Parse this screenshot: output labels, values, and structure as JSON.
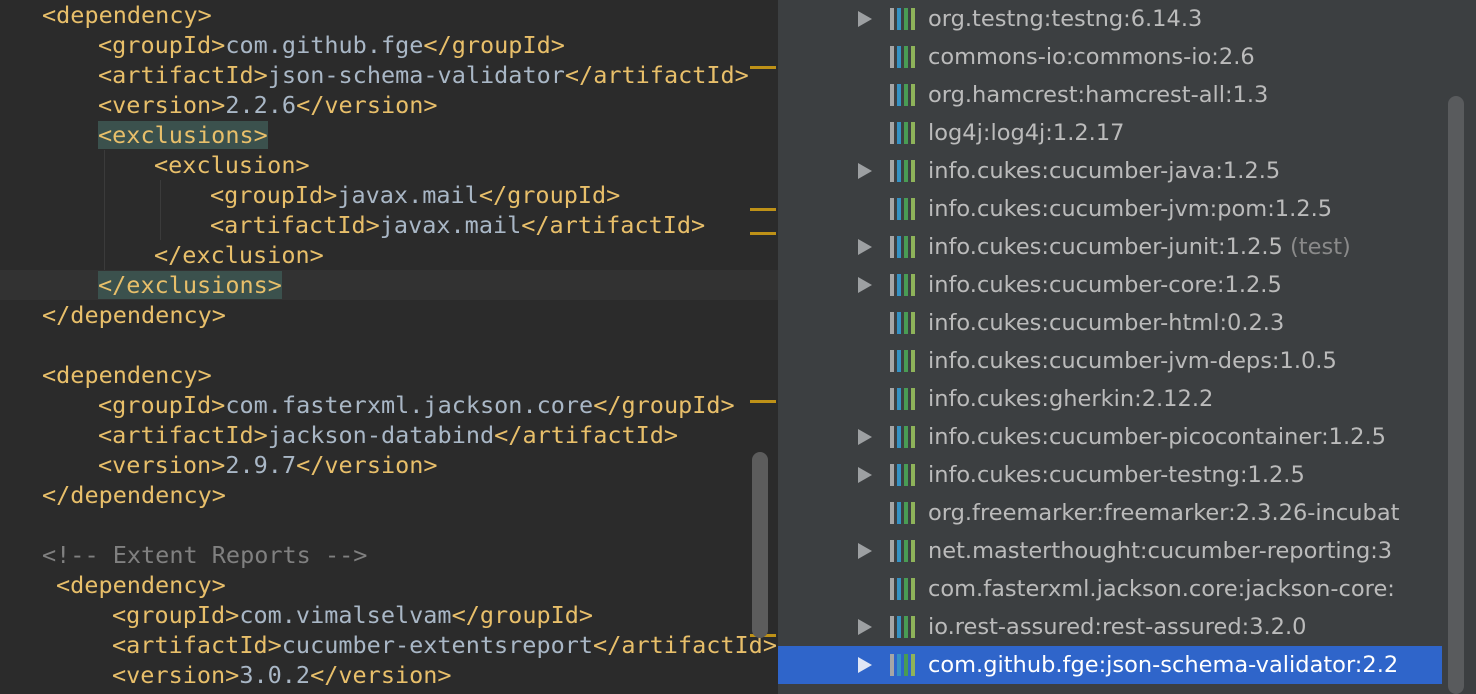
{
  "editor": {
    "lines": [
      [
        "<dependency>"
      ],
      [
        "<groupId>",
        "com.github.fge",
        "</groupId>"
      ],
      [
        "<artifactId>",
        "json-schema-validator",
        "</artifactId>"
      ],
      [
        "<version>",
        "2.2.6",
        "</version>"
      ],
      [
        "<exclusions>"
      ],
      [
        "<exclusion>"
      ],
      [
        "<groupId>",
        "javax.mail",
        "</groupId>"
      ],
      [
        "<artifactId>",
        "javax.mail",
        "</artifactId>"
      ],
      [
        "</exclusion>"
      ],
      [
        "</exclusions>"
      ],
      [
        "</dependency>"
      ],
      [
        "<dependency>"
      ],
      [
        "<groupId>",
        "com.fasterxml.jackson.core",
        "</groupId>"
      ],
      [
        "<artifactId>",
        "jackson-databind",
        "</artifactId>"
      ],
      [
        "<version>",
        "2.9.7",
        "</version>"
      ],
      [
        "</dependency>"
      ],
      [
        "<!-- Extent Reports -->"
      ],
      [
        "<dependency>"
      ],
      [
        "<groupId>",
        "com.vimalselvam",
        "</groupId>"
      ],
      [
        "<artifactId>",
        "cucumber-extentsreport",
        "</artifactId>"
      ],
      [
        "<version>",
        "3.0.2",
        "</version>"
      ]
    ]
  },
  "maven_tree": {
    "items": [
      {
        "label": "org.testng:testng:6.14.3"
      },
      {
        "label": "commons-io:commons-io:2.6"
      },
      {
        "label": "org.hamcrest:hamcrest-all:1.3"
      },
      {
        "label": "log4j:log4j:1.2.17"
      },
      {
        "label": "info.cukes:cucumber-java:1.2.5"
      },
      {
        "label": "info.cukes:cucumber-jvm:pom:1.2.5"
      },
      {
        "label": "info.cukes:cucumber-junit:1.2.5",
        "scope": "(test)"
      },
      {
        "label": "info.cukes:cucumber-core:1.2.5"
      },
      {
        "label": "info.cukes:cucumber-html:0.2.3"
      },
      {
        "label": "info.cukes:cucumber-jvm-deps:1.0.5"
      },
      {
        "label": "info.cukes:gherkin:2.12.2"
      },
      {
        "label": "info.cukes:cucumber-picocontainer:1.2.5"
      },
      {
        "label": "info.cukes:cucumber-testng:1.2.5"
      },
      {
        "label": "org.freemarker:freemarker:2.3.26-incubat"
      },
      {
        "label": "net.masterthought:cucumber-reporting:3"
      },
      {
        "label": "com.fasterxml.jackson.core:jackson-core:"
      },
      {
        "label": "io.rest-assured:rest-assured:3.2.0"
      },
      {
        "label": "com.github.fge:json-schema-validator:2.2"
      }
    ],
    "selected_label": "com.github.fge:json-schema-validator:2.2",
    "icon": "maven-library-icon",
    "expand_icon": "expand-arrow-icon"
  },
  "colors": {
    "editor_background": "#2b2b2b",
    "tag": "#e8bf6a",
    "text": "#a9b7c6",
    "comment": "#808080",
    "tree_background": "#3c3f41",
    "selection": "#2f65ca"
  }
}
